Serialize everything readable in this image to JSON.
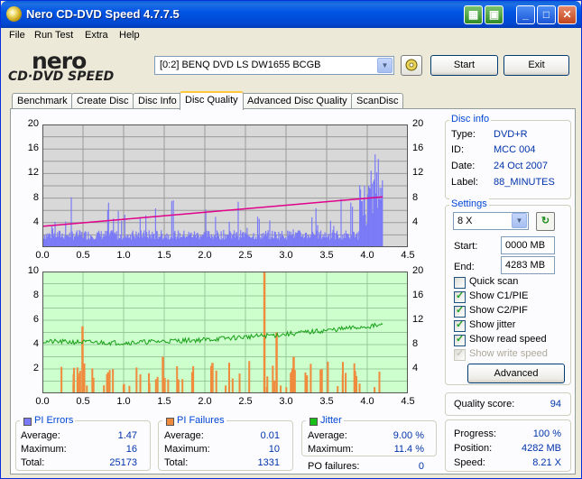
{
  "window": {
    "title": "Nero CD-DVD Speed 4.7.7.5"
  },
  "menu": [
    "File",
    "Run Test",
    "Extra",
    "Help"
  ],
  "logo": {
    "brand": "nero",
    "product": "CD·DVD SPEED"
  },
  "toolbar": {
    "drive": "[0:2]   BENQ DVD LS DW1655 BCGB",
    "start_label": "Start",
    "exit_label": "Exit"
  },
  "tabs": [
    "Benchmark",
    "Create Disc",
    "Disc Info",
    "Disc Quality",
    "Advanced Disc Quality",
    "ScanDisc"
  ],
  "active_tab": "Disc Quality",
  "disc_info": {
    "title": "Disc info",
    "type_label": "Type:",
    "type": "DVD+R",
    "id_label": "ID:",
    "id": "MCC 004",
    "date_label": "Date:",
    "date": "24 Oct 2007",
    "label_label": "Label:",
    "label": "88_MINUTES"
  },
  "settings": {
    "title": "Settings",
    "speed": "8 X",
    "start_label": "Start:",
    "start": "0000 MB",
    "end_label": "End:",
    "end": "4283 MB",
    "quick_scan": "Quick scan",
    "show_c1pie": "Show C1/PIE",
    "show_c2pif": "Show C2/PIF",
    "show_jitter": "Show jitter",
    "show_read_speed": "Show read speed",
    "show_write_speed": "Show write speed",
    "advanced_label": "Advanced"
  },
  "quality": {
    "label": "Quality score:",
    "value": "94"
  },
  "progress": {
    "progress_label": "Progress:",
    "progress": "100 %",
    "position_label": "Position:",
    "position": "4282 MB",
    "speed_label": "Speed:",
    "speed": "8.21 X"
  },
  "pi_errors": {
    "title": "PI Errors",
    "color": "#7b7bf7",
    "avg_label": "Average:",
    "avg": "1.47",
    "max_label": "Maximum:",
    "max": "16",
    "total_label": "Total:",
    "total": "25173"
  },
  "pi_failures": {
    "title": "PI Failures",
    "color": "#f08a3c",
    "avg_label": "Average:",
    "avg": "0.01",
    "max_label": "Maximum:",
    "max": "10",
    "total_label": "Total:",
    "total": "1331"
  },
  "jitter": {
    "title": "Jitter",
    "color": "#18c018",
    "avg_label": "Average:",
    "avg": "9.00 %",
    "max_label": "Maximum:",
    "max": "11.4 %",
    "po_label": "PO failures:",
    "po": "0"
  },
  "chart_data": [
    {
      "type": "bar",
      "title": "",
      "x_ticks": [
        "0.0",
        "0.5",
        "1.0",
        "1.5",
        "2.0",
        "2.5",
        "3.0",
        "3.5",
        "4.0",
        "4.5"
      ],
      "y_left_ticks": [
        "20",
        "16",
        "12",
        "8",
        "4"
      ],
      "y_right_ticks": [
        "20",
        "16",
        "12",
        "8",
        "4"
      ],
      "xlim": [
        0,
        4.5
      ],
      "ylim": [
        0,
        20
      ],
      "series": [
        {
          "name": "PI Errors",
          "color": "#7b7bf7"
        },
        {
          "name": "Read speed",
          "color": "#e0008a"
        }
      ],
      "read_speed": {
        "x": [
          0.0,
          4.19
        ],
        "y": [
          3.4,
          8.2
        ]
      },
      "pi_max": 16,
      "pi_avg": 1.47
    },
    {
      "type": "bar",
      "title": "",
      "x_ticks": [
        "0.0",
        "0.5",
        "1.0",
        "1.5",
        "2.0",
        "2.5",
        "3.0",
        "3.5",
        "4.0",
        "4.5"
      ],
      "y_left_ticks": [
        "10",
        "8",
        "6",
        "4",
        "2"
      ],
      "y_right_ticks": [
        "20",
        "16",
        "12",
        "8",
        "4"
      ],
      "xlim": [
        0,
        4.5
      ],
      "ylim": [
        0,
        10
      ],
      "series": [
        {
          "name": "PI Failures",
          "color": "#f08a3c"
        },
        {
          "name": "Jitter",
          "color": "#18a018"
        }
      ],
      "jitter": {
        "x": [
          0.0,
          1.0,
          2.0,
          3.0,
          4.19
        ],
        "y": [
          8.5,
          8.3,
          8.8,
          9.7,
          11.2
        ]
      },
      "pif_peaks": [
        {
          "x": 0.48,
          "y": 5.5
        },
        {
          "x": 1.47,
          "y": 3
        },
        {
          "x": 2.72,
          "y": 10
        },
        {
          "x": 2.87,
          "y": 5
        },
        {
          "x": 2.08,
          "y": 2.5
        },
        {
          "x": 3.08,
          "y": 3
        }
      ]
    }
  ]
}
